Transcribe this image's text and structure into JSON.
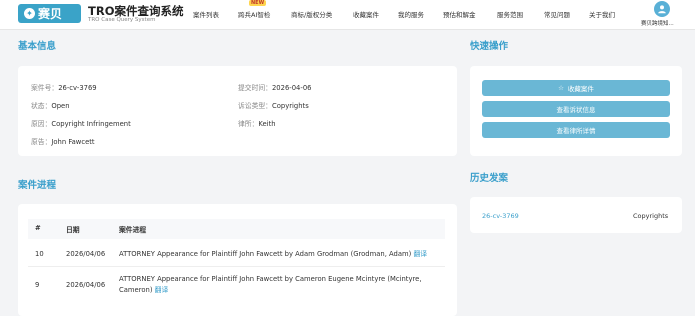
{
  "header": {
    "logo_text": "赛贝",
    "system_title": "TRO案件查询系统",
    "system_subtitle": "TRO Case Query System",
    "nav": [
      {
        "label": "案件列表"
      },
      {
        "label": "跨兵AI智检"
      },
      {
        "label": "商标/版权分类"
      },
      {
        "label": "收藏案件"
      },
      {
        "label": "我的服务"
      },
      {
        "label": "预估和解金"
      },
      {
        "label": "服务范围"
      },
      {
        "label": "常见问题"
      },
      {
        "label": "关于我们"
      }
    ],
    "new_badge": "NEW",
    "user_name": "赛贝跨境知..."
  },
  "basic_info": {
    "title": "基本信息",
    "case_no_label": "案件号：",
    "case_no": "26-cv-3769",
    "filed_label": "提交时间：",
    "filed": "2026-04-06",
    "status_label": "状态：",
    "status": "Open",
    "type_label": "诉讼类型：",
    "type": "Copyrights",
    "cause_label": "原因：",
    "cause": "Copyright Infringement",
    "lawyer_label": "律所：",
    "lawyer": "Keith",
    "plaintiff_label": "原告：",
    "plaintiff": "John Fawcett"
  },
  "quick_actions": {
    "title": "快速操作",
    "favorite": "收藏案件",
    "view_complaint": "查看诉状信息",
    "view_lawyer": "查看律所详情"
  },
  "progress": {
    "title": "案件进程",
    "col_no": "#",
    "col_date": "日期",
    "col_desc": "案件进程",
    "rows": [
      {
        "no": "10",
        "date": "2026/04/06",
        "desc": "ATTORNEY Appearance for Plaintiff John Fawcett by Adam Grodman (Grodman, Adam)",
        "link": "翻译"
      },
      {
        "no": "9",
        "date": "2026/04/06",
        "desc": "ATTORNEY Appearance for Plaintiff John Fawcett by Cameron Eugene Mcintyre (Mcintyre, Cameron)",
        "link": "翻译"
      }
    ]
  },
  "history": {
    "title": "历史发案",
    "case_no": "26-cv-3769",
    "type": "Copyrights"
  },
  "colors": {
    "accent": "#3a9fcb",
    "button": "#6ab7d5",
    "logo_bg": "#3aa3c8"
  }
}
